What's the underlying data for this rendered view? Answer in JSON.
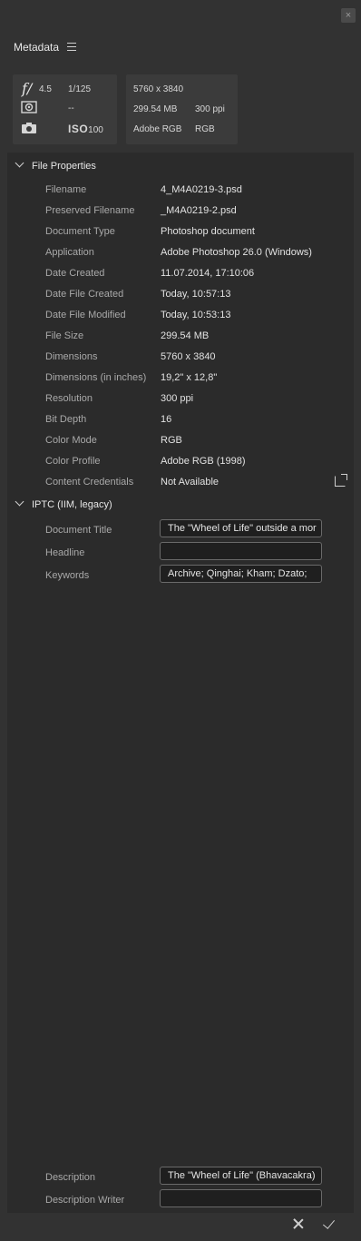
{
  "window": {
    "close_glyph": "×"
  },
  "panel": {
    "title": "Metadata",
    "menu_icon": "hamburger-icon"
  },
  "camera": {
    "fstop": "4.5",
    "shutter": "1/125",
    "metering": "--",
    "iso_label": "ISO",
    "iso": "100",
    "dimensions": "5760 x 3840",
    "size": "299.54 MB",
    "resolution": "300 ppi",
    "profile": "Adobe RGB",
    "mode": "RGB"
  },
  "file_properties": {
    "title": "File Properties",
    "rows": [
      {
        "label": "Filename",
        "value": "4_M4A0219-3.psd"
      },
      {
        "label": "Preserved Filename",
        "value": "_M4A0219-2.psd"
      },
      {
        "label": "Document Type",
        "value": "Photoshop document"
      },
      {
        "label": "Application",
        "value": "Adobe Photoshop 26.0 (Windows)"
      },
      {
        "label": "Date Created",
        "value": "11.07.2014, 17:10:06"
      },
      {
        "label": "Date File Created",
        "value": "Today, 10:57:13"
      },
      {
        "label": "Date File Modified",
        "value": "Today, 10:53:13"
      },
      {
        "label": "File Size",
        "value": "299.54 MB"
      },
      {
        "label": "Dimensions",
        "value": "5760 x 3840"
      },
      {
        "label": "Dimensions (in inches)",
        "value": "19,2\" x 12,8\""
      },
      {
        "label": "Resolution",
        "value": "300 ppi"
      },
      {
        "label": "Bit Depth",
        "value": "16"
      },
      {
        "label": "Color Mode",
        "value": "RGB"
      },
      {
        "label": "Color Profile",
        "value": "Adobe RGB (1998)"
      },
      {
        "label": "Content Credentials",
        "value": "Not Available"
      }
    ]
  },
  "iptc": {
    "title": "IPTC (IIM, legacy)",
    "document_title_label": "Document Title",
    "document_title_value": "The \"Wheel of Life\" outside a mor",
    "headline_label": "Headline",
    "headline_value": "",
    "keywords_label": "Keywords",
    "keywords_value": "Archive; Qinghai; Kham; Dzato;",
    "description_label": "Description",
    "description_value": "The \"Wheel of Life\" (Bhavacakra)",
    "description_writer_label": "Description Writer",
    "description_writer_value": ""
  }
}
